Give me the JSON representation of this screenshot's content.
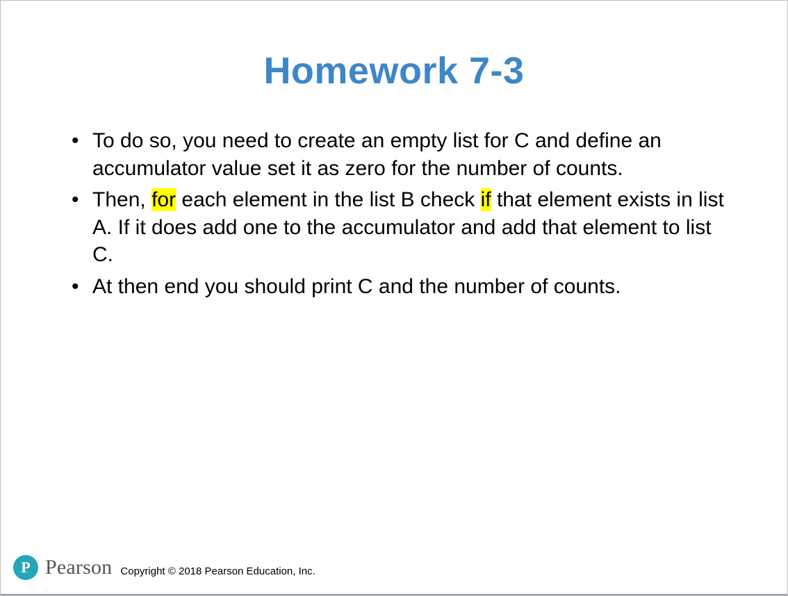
{
  "title": "Homework 7-3",
  "bullets": [
    {
      "segments": [
        {
          "text": "To do so, you need to create an empty list for C and define an accumulator value set it as zero for the number of counts.",
          "highlight": false
        }
      ]
    },
    {
      "segments": [
        {
          "text": "Then, ",
          "highlight": false
        },
        {
          "text": "for",
          "highlight": true
        },
        {
          "text": " each element in the list B check ",
          "highlight": false
        },
        {
          "text": "if",
          "highlight": true
        },
        {
          "text": " that element exists in list A. If it does add one to the accumulator and add that element to list C.",
          "highlight": false
        }
      ]
    },
    {
      "segments": [
        {
          "text": "At then end you should print C and the number of counts.",
          "highlight": false
        }
      ]
    }
  ],
  "footer": {
    "logo_letter": "P",
    "brand": "Pearson",
    "copyright": "Copyright © 2018 Pearson Education, Inc."
  },
  "colors": {
    "title": "#3e87c6",
    "highlight": "#ffff00",
    "logo": "#23a6b8"
  }
}
